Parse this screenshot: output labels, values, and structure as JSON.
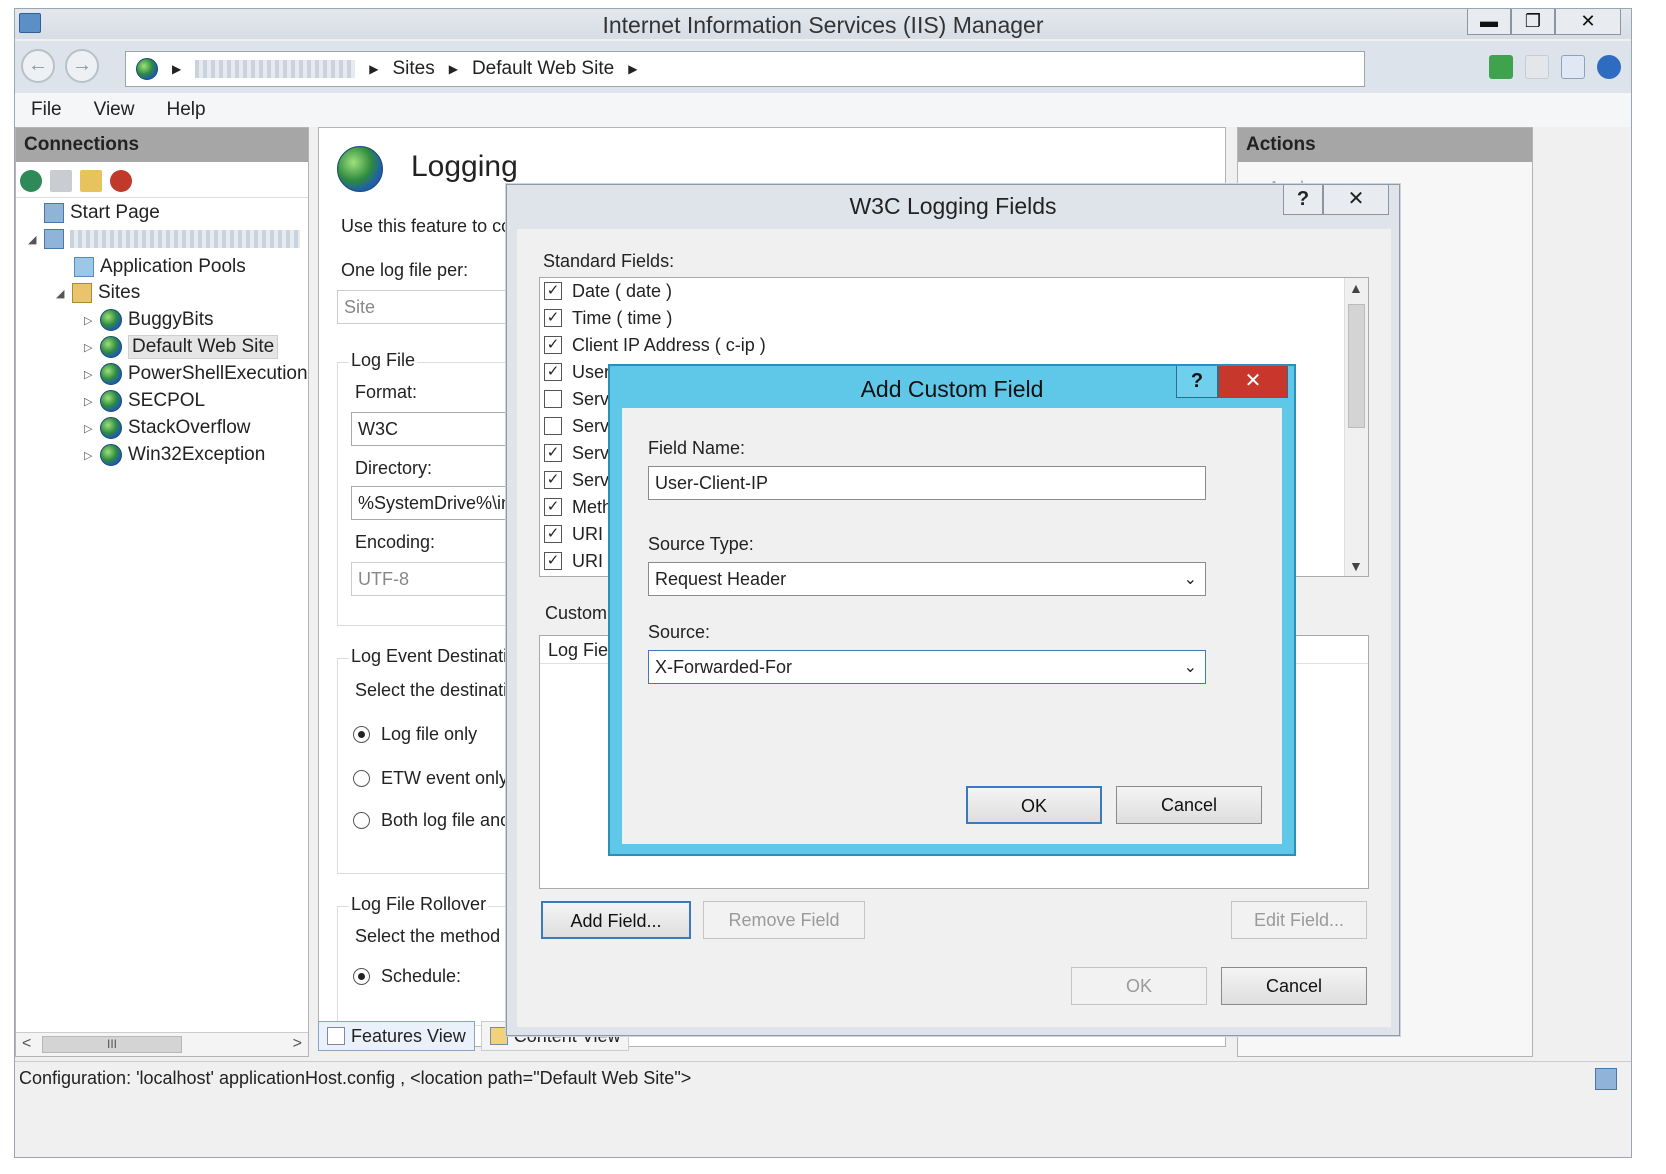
{
  "window": {
    "title": "Internet Information Services (IIS) Manager",
    "btn_min": "▬",
    "btn_max": "❐",
    "btn_close": "✕"
  },
  "address": {
    "crumbs": [
      "Sites",
      "Default Web Site"
    ]
  },
  "menu": {
    "file": "File",
    "view": "View",
    "help": "Help"
  },
  "connections": {
    "header": "Connections",
    "tree": {
      "start_page": "Start Page",
      "app_pools": "Application Pools",
      "sites": "Sites",
      "site_items": [
        "BuggyBits",
        "Default Web Site",
        "PowerShellExecution",
        "SECPOL",
        "StackOverflow",
        "Win32Exception"
      ]
    },
    "scroll_thumb": "III"
  },
  "logging": {
    "title": "Logging",
    "description": "Use this feature to co",
    "one_log_label": "One log file per:",
    "one_log_value": "Site",
    "log_file_group": "Log File",
    "format_label": "Format:",
    "format_value": "W3C",
    "directory_label": "Directory:",
    "directory_value": "%SystemDrive%\\in",
    "encoding_label": "Encoding:",
    "encoding_value": "UTF-8",
    "event_dest_group": "Log Event Destinatic",
    "event_dest_desc": "Select the destinati",
    "opt_log_file_only": "Log file only",
    "opt_etw_only": "ETW event only",
    "opt_both": "Both log file anc",
    "rollover_group": "Log File Rollover",
    "rollover_desc": "Select the method f",
    "opt_schedule": "Schedule:"
  },
  "view_tabs": {
    "features": "Features View",
    "content": "Content View"
  },
  "actions": {
    "header": "Actions",
    "apply": "Apply"
  },
  "status": {
    "text": "Configuration: 'localhost' applicationHost.config , <location path=\"Default Web Site\">"
  },
  "w3c_dialog": {
    "title": "W3C Logging Fields",
    "help": "?",
    "close": "✕",
    "standard_label": "Standard Fields:",
    "fields": [
      {
        "label": "Date ( date )",
        "checked": true
      },
      {
        "label": "Time ( time )",
        "checked": true
      },
      {
        "label": "Client IP Address ( c-ip )",
        "checked": true
      },
      {
        "label": "User",
        "checked": true
      },
      {
        "label": "Servi",
        "checked": false
      },
      {
        "label": "Serve",
        "checked": false
      },
      {
        "label": "Serve",
        "checked": true
      },
      {
        "label": "Serve",
        "checked": true
      },
      {
        "label": "Meth",
        "checked": true
      },
      {
        "label": "URI S",
        "checked": true
      },
      {
        "label": "URI C",
        "checked": true
      }
    ],
    "custom_label": "Custom",
    "custom_col": "Log Fiel",
    "add_field": "Add Field...",
    "remove_field": "Remove Field",
    "edit_field": "Edit Field...",
    "ok": "OK",
    "cancel": "Cancel"
  },
  "custom_dialog": {
    "title": "Add Custom Field",
    "help": "?",
    "close": "✕",
    "field_name_label": "Field Name:",
    "field_name_value": "User-Client-IP",
    "source_type_label": "Source Type:",
    "source_type_value": "Request Header",
    "source_label": "Source:",
    "source_value": "X-Forwarded-For",
    "ok": "OK",
    "cancel": "Cancel"
  }
}
